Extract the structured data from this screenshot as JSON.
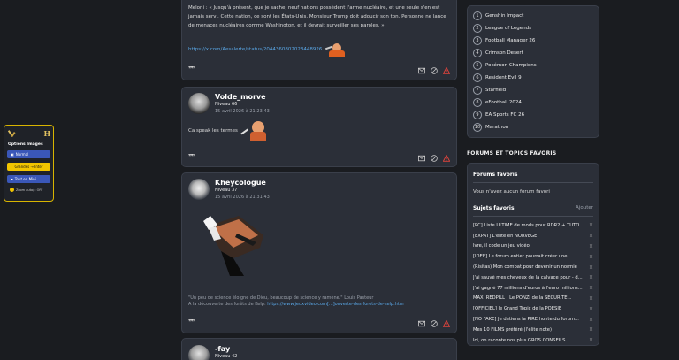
{
  "options_panel": {
    "h_letter": "H",
    "title": "Options Images",
    "btn_normal": "Normal",
    "btn_large": "Grandes → Inter",
    "btn_mini": "Tout en Mini",
    "zoom": "Zoom auto/ : OFF"
  },
  "post1": {
    "text": "Meloni : « Jusqu'à présent, que je sache, neuf nations possèdent l'arme nucléaire, et une seule s'en est jamais servi. Cette nation, ce sont les États-Unis. Monsieur Trump doit adoucir son ton. Personne ne lance de menaces nucléaires comme Washington, et il devrait surveiller ses paroles. »",
    "link": "https://x.com/Aesalerte/status/2044360802023448926"
  },
  "post2": {
    "name": "Volde_morve",
    "level": "Niveau 66",
    "date": "15 avril 2026 à 21:23:43",
    "text": "Ca speak les termes"
  },
  "post3": {
    "name": "Kheycologue",
    "level": "Niveau 37",
    "date": "15 avril 2026 à 21:31:43",
    "sig_line1": "\"Un peu de science éloigne de Dieu, beaucoup de science y ramène.\" Louis Pasteur",
    "sig_line2_prefix": "A la découverte des forêts de Kelp: ",
    "sig_link": "https://www.jeuxvideo.com[...]ouverte-des-forets-de-kelp.htm"
  },
  "post4": {
    "name": "-fay",
    "level": "Niveau 42"
  },
  "ranking": [
    {
      "num": "1",
      "label": "Genshin Impact"
    },
    {
      "num": "2",
      "label": "League of Legends"
    },
    {
      "num": "3",
      "label": "Football Manager 26"
    },
    {
      "num": "4",
      "label": "Crimson Desert"
    },
    {
      "num": "5",
      "label": "Pokémon Champions"
    },
    {
      "num": "6",
      "label": "Resident Evil 9"
    },
    {
      "num": "7",
      "label": "Starfield"
    },
    {
      "num": "8",
      "label": "eFootball 2024"
    },
    {
      "num": "9",
      "label": "EA Sports FC 26"
    },
    {
      "num": "10",
      "label": "Marathon"
    }
  ],
  "forums": {
    "section_title": "FORUMS ET TOPICS FAVORIS",
    "fav_forums_title": "Forums favoris",
    "no_forum": "Vous n'avez aucun forum favori",
    "fav_topics_title": "Sujets favoris",
    "add": "Ajouter",
    "topics": [
      "[PC] Liste ULTIME de mods pour RDR2 + TUTO",
      "[EXPAT] L'élite en NORVEGE",
      "Ivre, il code un jeu vidéo",
      "[IDEE] Le forum entier pourrait créer une...",
      "(Risitas) Mon combat pour devenir un normie",
      "J'ai sauvé mes cheveux de la calvace pour - d...",
      "J'ai gagné 77 millions d'euros à l'euro millions...",
      "MAXI REDPILL : Le PONZI de la SECURITE...",
      "[OFFICIEL] le Grand Topic de la POÉSIE",
      "[NO FAKE] Je detiens la PIRE honte du forum...",
      "Mes 10 FILMS préféré (l'élite note)",
      "Ici, on raconte nos plus GROS CONSEILS..."
    ],
    "remove_symbol": "×"
  },
  "icons": {
    "quote": "quote-icon",
    "mail": "mail-icon",
    "block": "block-icon",
    "alert": "alert-icon"
  },
  "colors": {
    "accent_yellow": "#d8b400",
    "link": "#5aa8e8",
    "alert_red": "#e0443c"
  }
}
